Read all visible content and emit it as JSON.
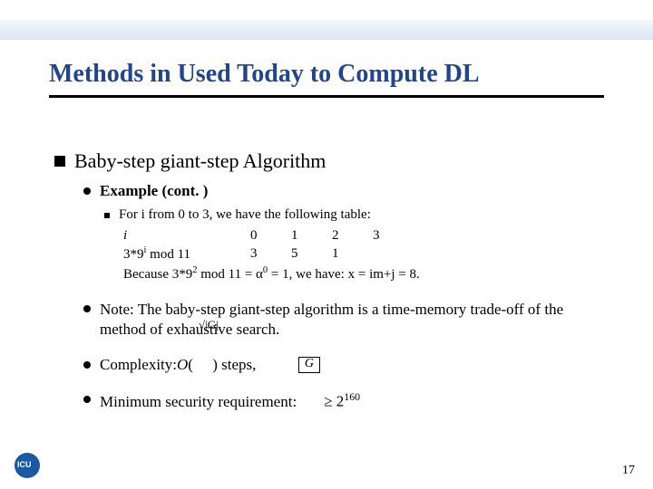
{
  "title": "Methods in Used Today to Compute DL",
  "section": "Baby-step giant-step Algorithm",
  "example_label": "Example (cont. )",
  "table_intro": "For i from 0 to 3, we have the following table:",
  "table": {
    "row1_label": "i",
    "row1_vals": [
      "0",
      "1",
      "2",
      "3"
    ],
    "row2_label_html": "3*9ⁱ mod 11",
    "row2_vals": [
      "3",
      "5",
      "1",
      ""
    ]
  },
  "conclusion_prefix": "Because 3*9",
  "conclusion_exp1": "2",
  "conclusion_mid": " mod 11 = α",
  "conclusion_exp2": "0",
  "conclusion_suffix": " = 1, we have: x = im+j = 8.",
  "note": "Note: The baby-step giant-step algorithm is a time-memory trade-off of the method of exhaustive search.",
  "complexity_label": "Complexity: ",
  "complexity_O": "O",
  "complexity_open": "(",
  "complexity_close": ") steps,",
  "minreq_label": "Minimum security requirement:",
  "minreq_value_prefix": "≥ 2",
  "minreq_value_exp": "160",
  "page_number": "17",
  "sqrt_fragment": "√|G|"
}
